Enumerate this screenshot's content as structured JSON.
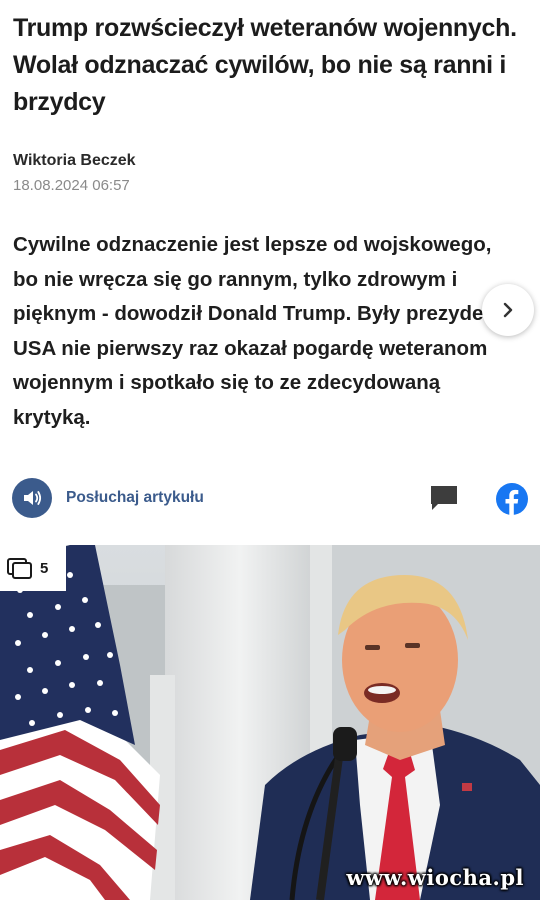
{
  "article": {
    "headline": "Trump rozwścieczył weteranów wojennych. Wolał odznaczać cywilów, bo nie są ranni i brzydcy",
    "author": "Wiktoria Beczek",
    "date": "18.08.2024 06:57",
    "lead": "Cywilne odznaczenie jest lepsze od wojskowego, bo nie wręcza się go rannym, tylko zdrowym i pięknym - dowodził Donald Trump. Były prezydent USA nie pierwszy raz okazał pogardę weteranom wojennym i spotkało się to ze zdecydowaną krytyką."
  },
  "actions": {
    "listen_label": "Posłuchaj artykułu",
    "next_icon": "chevron-right-icon",
    "speaker_icon": "speaker-icon",
    "comment_icon": "comment-icon",
    "share_icon": "facebook-icon"
  },
  "photo": {
    "gallery_count": "5",
    "gallery_icon": "gallery-icon",
    "watermark": "www.wiocha.pl"
  },
  "colors": {
    "accent": "#3b5b8c",
    "facebook": "#1877f2",
    "text": "#1c1c1c",
    "muted": "#8a8a8a"
  }
}
